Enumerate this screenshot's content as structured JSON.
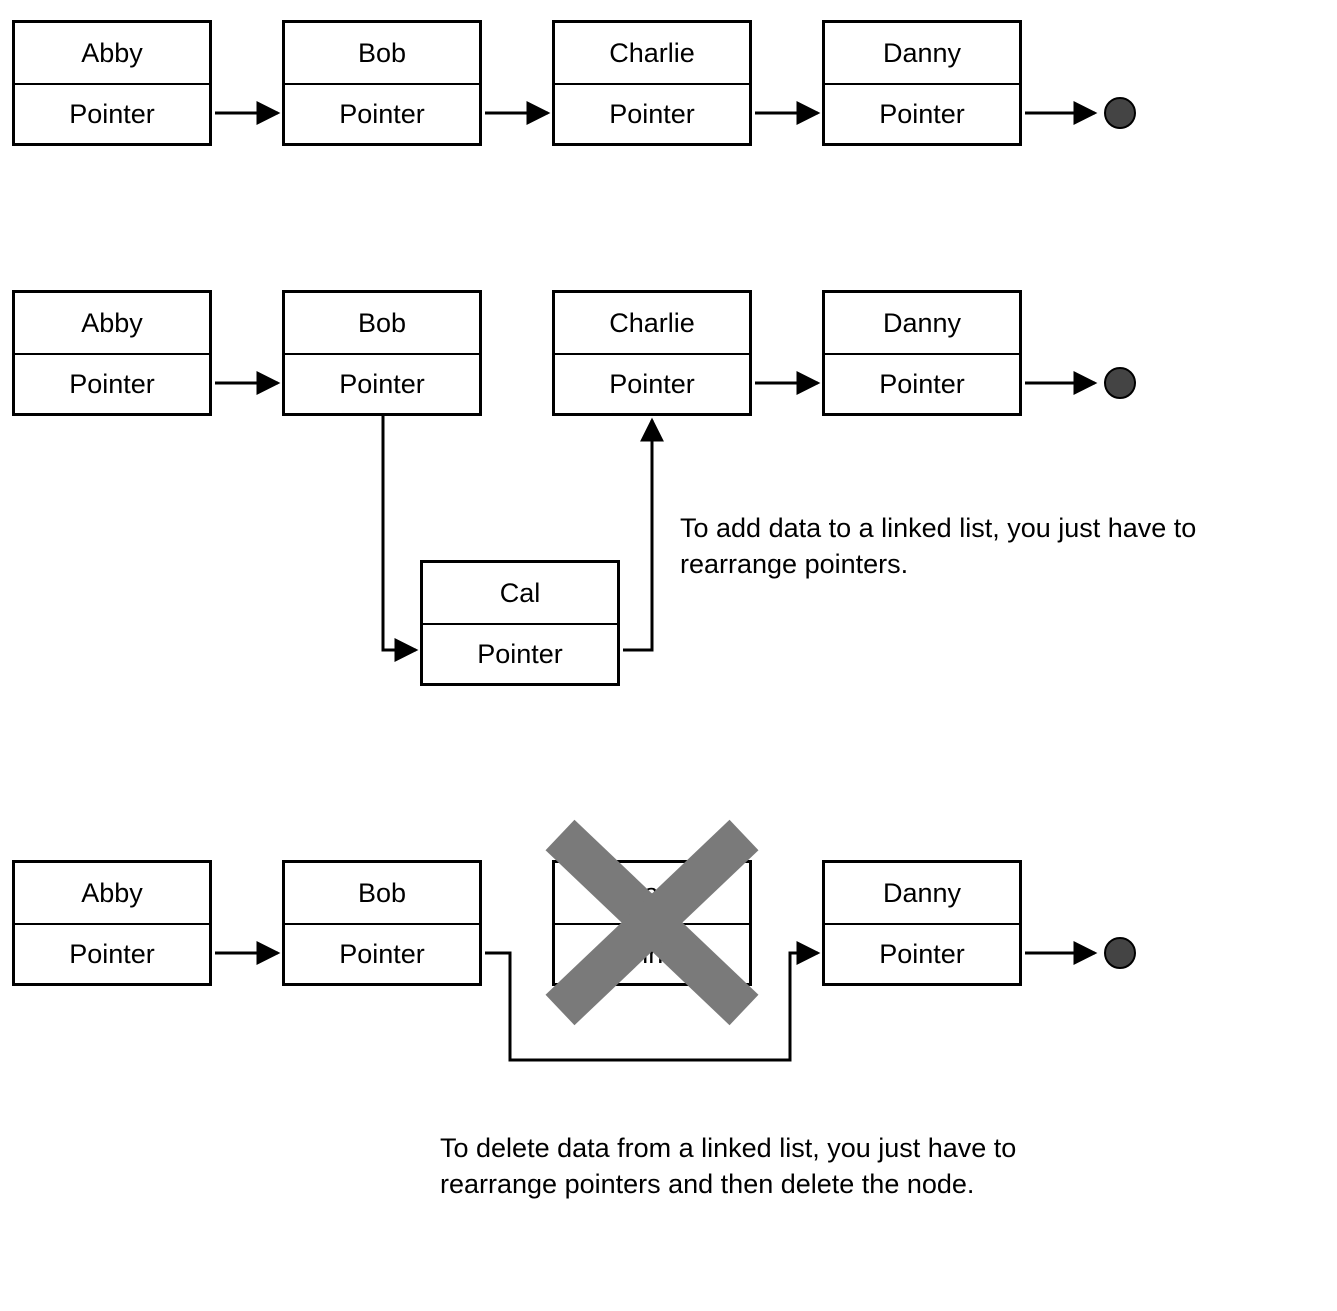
{
  "pointer_label": "Pointer",
  "nodes": {
    "row1": [
      {
        "name": "Abby"
      },
      {
        "name": "Bob"
      },
      {
        "name": "Charlie"
      },
      {
        "name": "Danny"
      }
    ],
    "row2": [
      {
        "name": "Abby"
      },
      {
        "name": "Bob"
      },
      {
        "name": "Charlie"
      },
      {
        "name": "Danny"
      }
    ],
    "insert_node": {
      "name": "Cal"
    },
    "row3": [
      {
        "name": "Abby"
      },
      {
        "name": "Bob"
      },
      {
        "name": "Charlie"
      },
      {
        "name": "Danny"
      }
    ]
  },
  "captions": {
    "add": "To add data to a linked list, you just have to rearrange pointers.",
    "delete": "To delete data from a linked list, you just have to rearrange pointers and then delete the node."
  }
}
